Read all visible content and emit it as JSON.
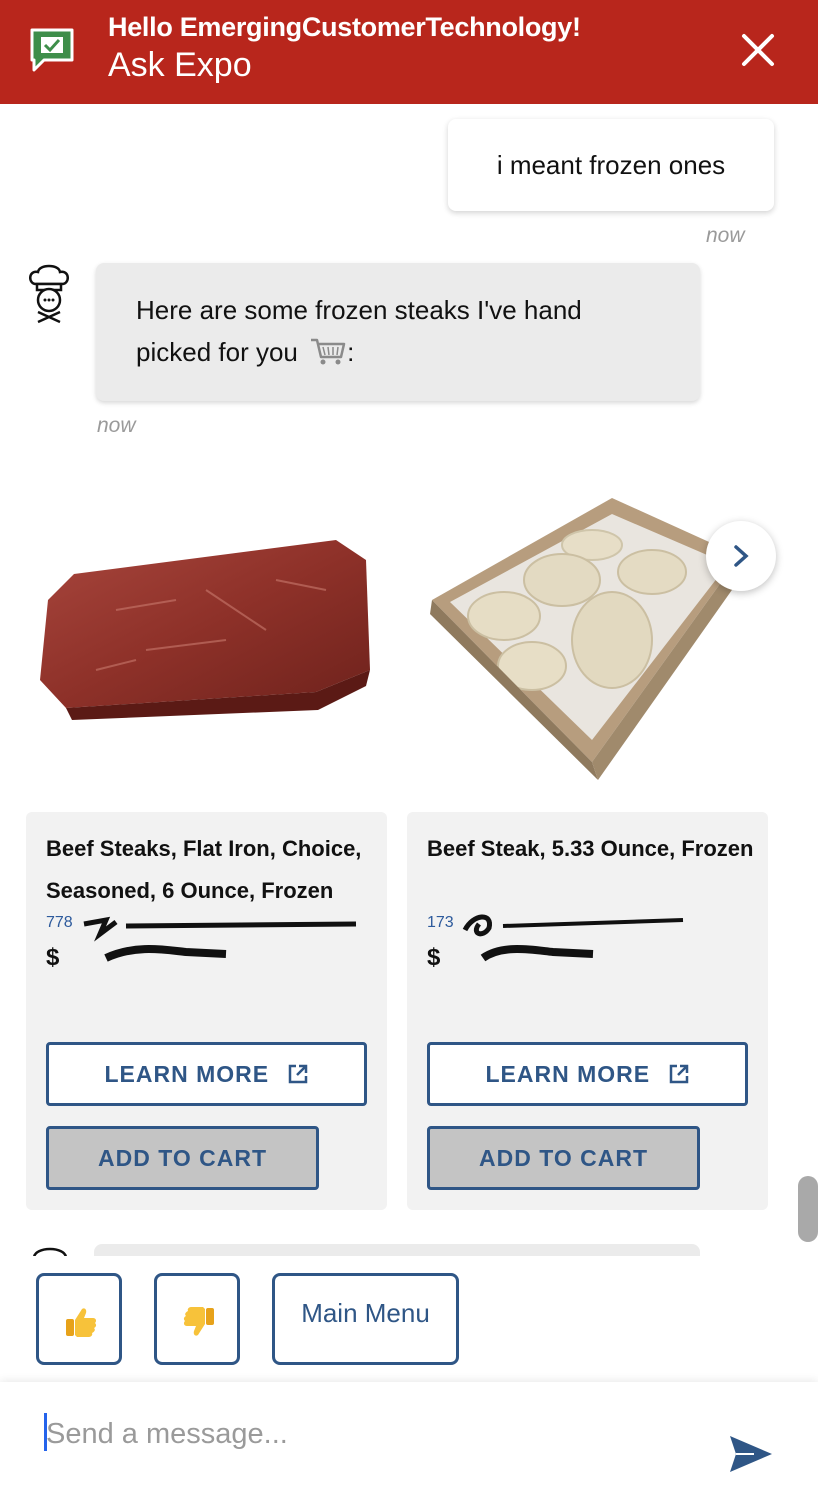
{
  "header": {
    "greeting": "Hello EmergingCustomerTechnology!",
    "title": "Ask Expo",
    "accent_color": "#b8261c",
    "logo_icon": "chat-check-icon",
    "close_icon": "close-icon"
  },
  "conversation": {
    "user_message": "i meant frozen ones",
    "user_timestamp": "now",
    "bot_message": "Here are some frozen steaks I've hand picked for you",
    "bot_message_suffix": ":",
    "bot_timestamp": "now",
    "bot_avatar_icon": "chef-icon"
  },
  "products": [
    {
      "name": "Beef Steaks, Flat Iron, Choice, Seasoned, 6 Ounce, Frozen",
      "meta_visible": "778",
      "price_prefix": "$",
      "learn_more": "LEARN MORE",
      "add_to_cart": "ADD TO CART"
    },
    {
      "name": "Beef Steak, 5.33 Ounce, Frozen",
      "meta_visible": "173",
      "price_prefix": "$",
      "learn_more": "LEARN MORE",
      "add_to_cart": "ADD TO CART"
    }
  ],
  "quick_replies": {
    "thumbs_up_icon": "thumbs-up-icon",
    "thumbs_down_icon": "thumbs-down-icon",
    "main_menu": "Main Menu"
  },
  "composer": {
    "placeholder": "Send a message...",
    "send_icon": "send-icon"
  },
  "colors": {
    "primary_blue": "#2f5686",
    "link_blue": "#2d5a9c",
    "bubble_gray": "#ebebeb",
    "card_gray": "#f2f2f2"
  }
}
